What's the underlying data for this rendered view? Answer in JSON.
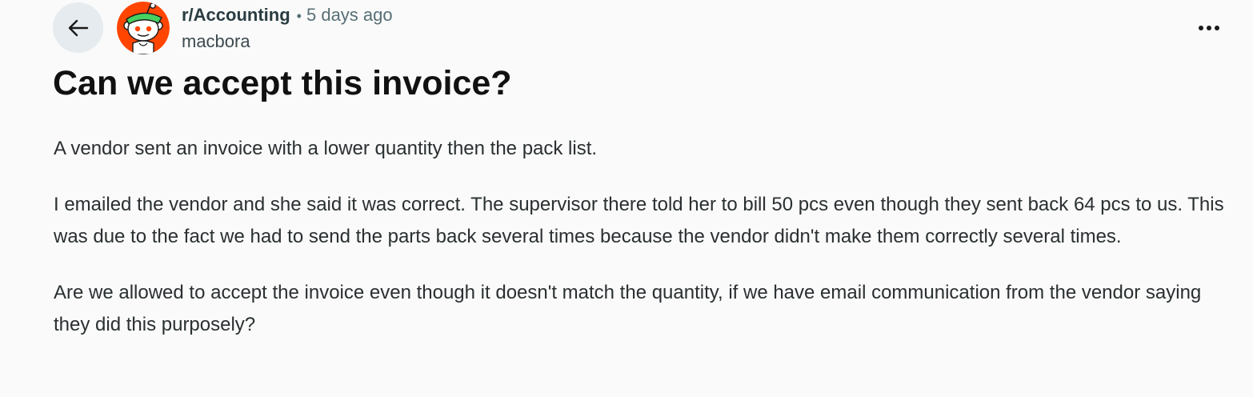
{
  "post": {
    "subreddit": "r/Accounting",
    "separator": "•",
    "time": "5 days ago",
    "author": "macbora",
    "title": "Can we accept this invoice?",
    "paragraphs": [
      "A vendor sent an invoice with a lower quantity then the pack list.",
      "I emailed the vendor and she said it was correct. The supervisor there told her to bill 50 pcs even though they sent back 64 pcs to us. This was due to the fact we had to send the parts back several times because the vendor didn't make them correctly several times.",
      "Are we allowed to accept the invoice even though it doesn't match the quantity, if we have email communication from the vendor saying they did this purposely?"
    ]
  },
  "icons": {
    "back": "arrow-left-icon",
    "more": "more-horizontal-icon",
    "avatar": "reddit-snoo-avatar"
  },
  "colors": {
    "background": "#f9faf9",
    "back_button_bg": "#e5ebee",
    "avatar_bg": "#ff4500",
    "avatar_visor": "#46d160"
  }
}
